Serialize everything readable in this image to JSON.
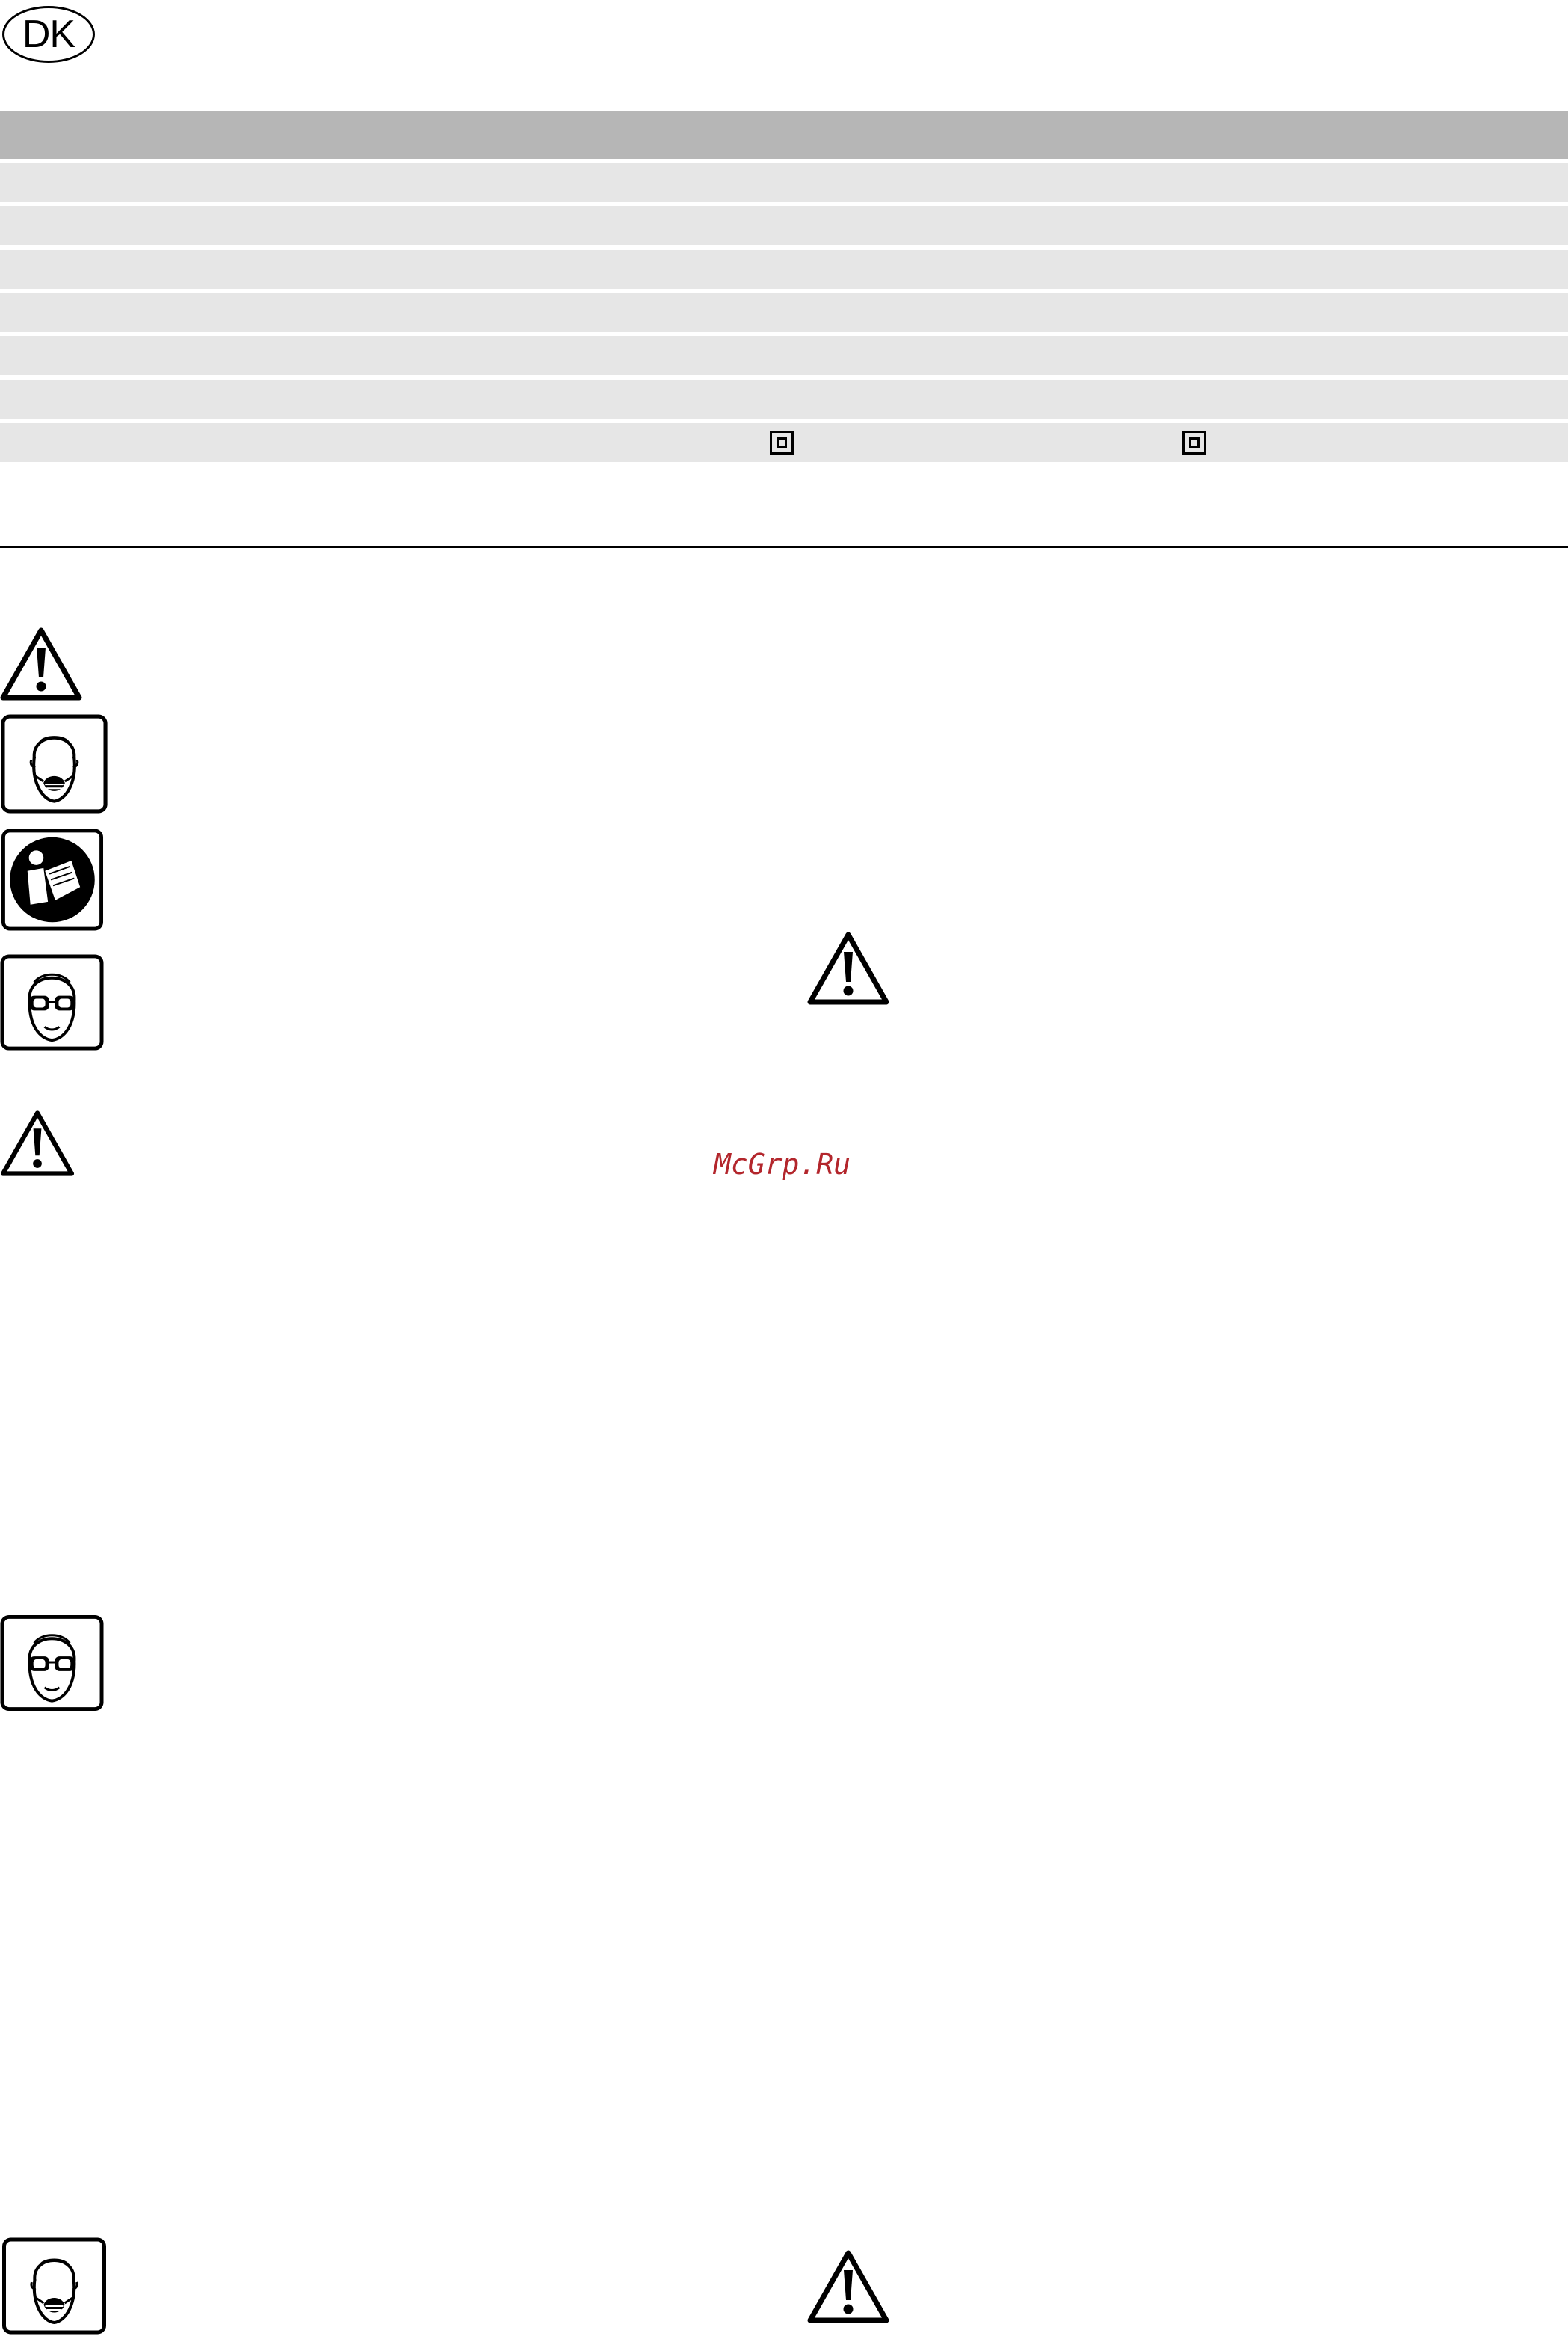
{
  "language_badge": "DK",
  "watermark": "McGrp.Ru",
  "table": {
    "row_count": 7,
    "class2_symbol_row": 7
  },
  "icons": [
    "warning-icon",
    "dust-mask-icon",
    "read-manual-icon",
    "safety-goggles-icon",
    "warning-icon",
    "warning-icon",
    "safety-goggles-icon",
    "dust-mask-icon",
    "warning-icon"
  ],
  "colors": {
    "header_gray": "#b6b6b6",
    "row_gray": "#e6e6e6",
    "watermark_red": "#b3262c"
  }
}
